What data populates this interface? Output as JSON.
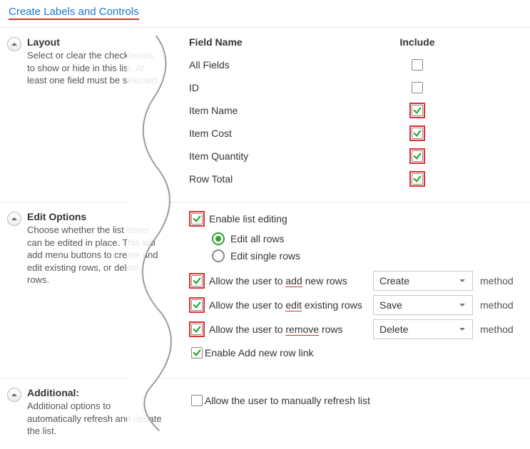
{
  "title": "Create Labels and Controls",
  "layout": {
    "heading": "Layout",
    "desc": "Select or clear the checkboxes to show or hide in this list. At least one field must be selected.",
    "columns": {
      "name": "Field Name",
      "include": "Include"
    },
    "fields": [
      {
        "label": "All Fields",
        "checked": false,
        "highlight": false
      },
      {
        "label": "ID",
        "checked": false,
        "highlight": false
      },
      {
        "label": "Item Name",
        "checked": true,
        "highlight": true
      },
      {
        "label": "Item Cost",
        "checked": true,
        "highlight": true
      },
      {
        "label": "Item Quantity",
        "checked": true,
        "highlight": true
      },
      {
        "label": "Row Total",
        "checked": true,
        "highlight": true
      }
    ]
  },
  "edit": {
    "heading": "Edit Options",
    "desc": "Choose whether the list items can be edited in place. This will add menu buttons to create and edit existing rows, or delete rows.",
    "enable_label": "Enable list editing",
    "enable_checked": true,
    "enable_highlight": true,
    "mode": {
      "all": "Edit all rows",
      "single": "Edit single rows",
      "selected": "all"
    },
    "perms": [
      {
        "text_pre": "Allow the user to ",
        "keyword": "add",
        "text_post": " new rows",
        "checked": true,
        "highlight": true,
        "select": "Create",
        "method_label": "method"
      },
      {
        "text_pre": "Allow the user to ",
        "keyword": "edit",
        "text_post": " existing rows",
        "checked": true,
        "highlight": true,
        "select": "Save",
        "method_label": "method"
      },
      {
        "text_pre": "Allow the user to ",
        "keyword": "remove",
        "text_post": " rows",
        "checked": true,
        "highlight": true,
        "select": "Delete",
        "method_label": "method"
      }
    ],
    "enable_add_link": {
      "label": "Enable Add new row link",
      "checked": true
    }
  },
  "additional": {
    "heading": "Additional:",
    "desc": "Additional options to automatically refresh and update the list.",
    "refresh": {
      "label": "Allow the user to manually refresh list",
      "checked": false
    }
  }
}
